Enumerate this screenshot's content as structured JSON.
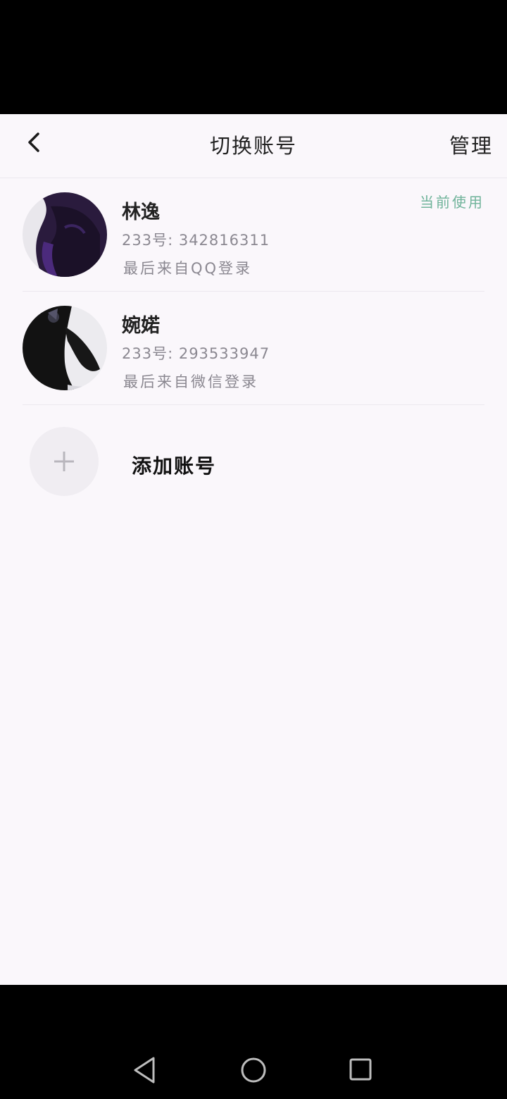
{
  "header": {
    "title": "切换账号",
    "manage_label": "管理"
  },
  "accounts": [
    {
      "nickname": "林逸",
      "uid": "233号: 342816311",
      "last_login": "最后来自QQ登录",
      "status": "当前使用"
    },
    {
      "nickname": "婉婼",
      "uid": "233号: 293533947",
      "last_login": "最后来自微信登录",
      "status": ""
    }
  ],
  "add_account": {
    "label": "添加账号"
  },
  "colors": {
    "background": "#faf7fb",
    "current_tag": "#6fb39a",
    "secondary_text": "#8b8891"
  },
  "nav": {
    "icons": [
      "back-triangle-icon",
      "home-circle-icon",
      "recents-square-icon"
    ]
  }
}
